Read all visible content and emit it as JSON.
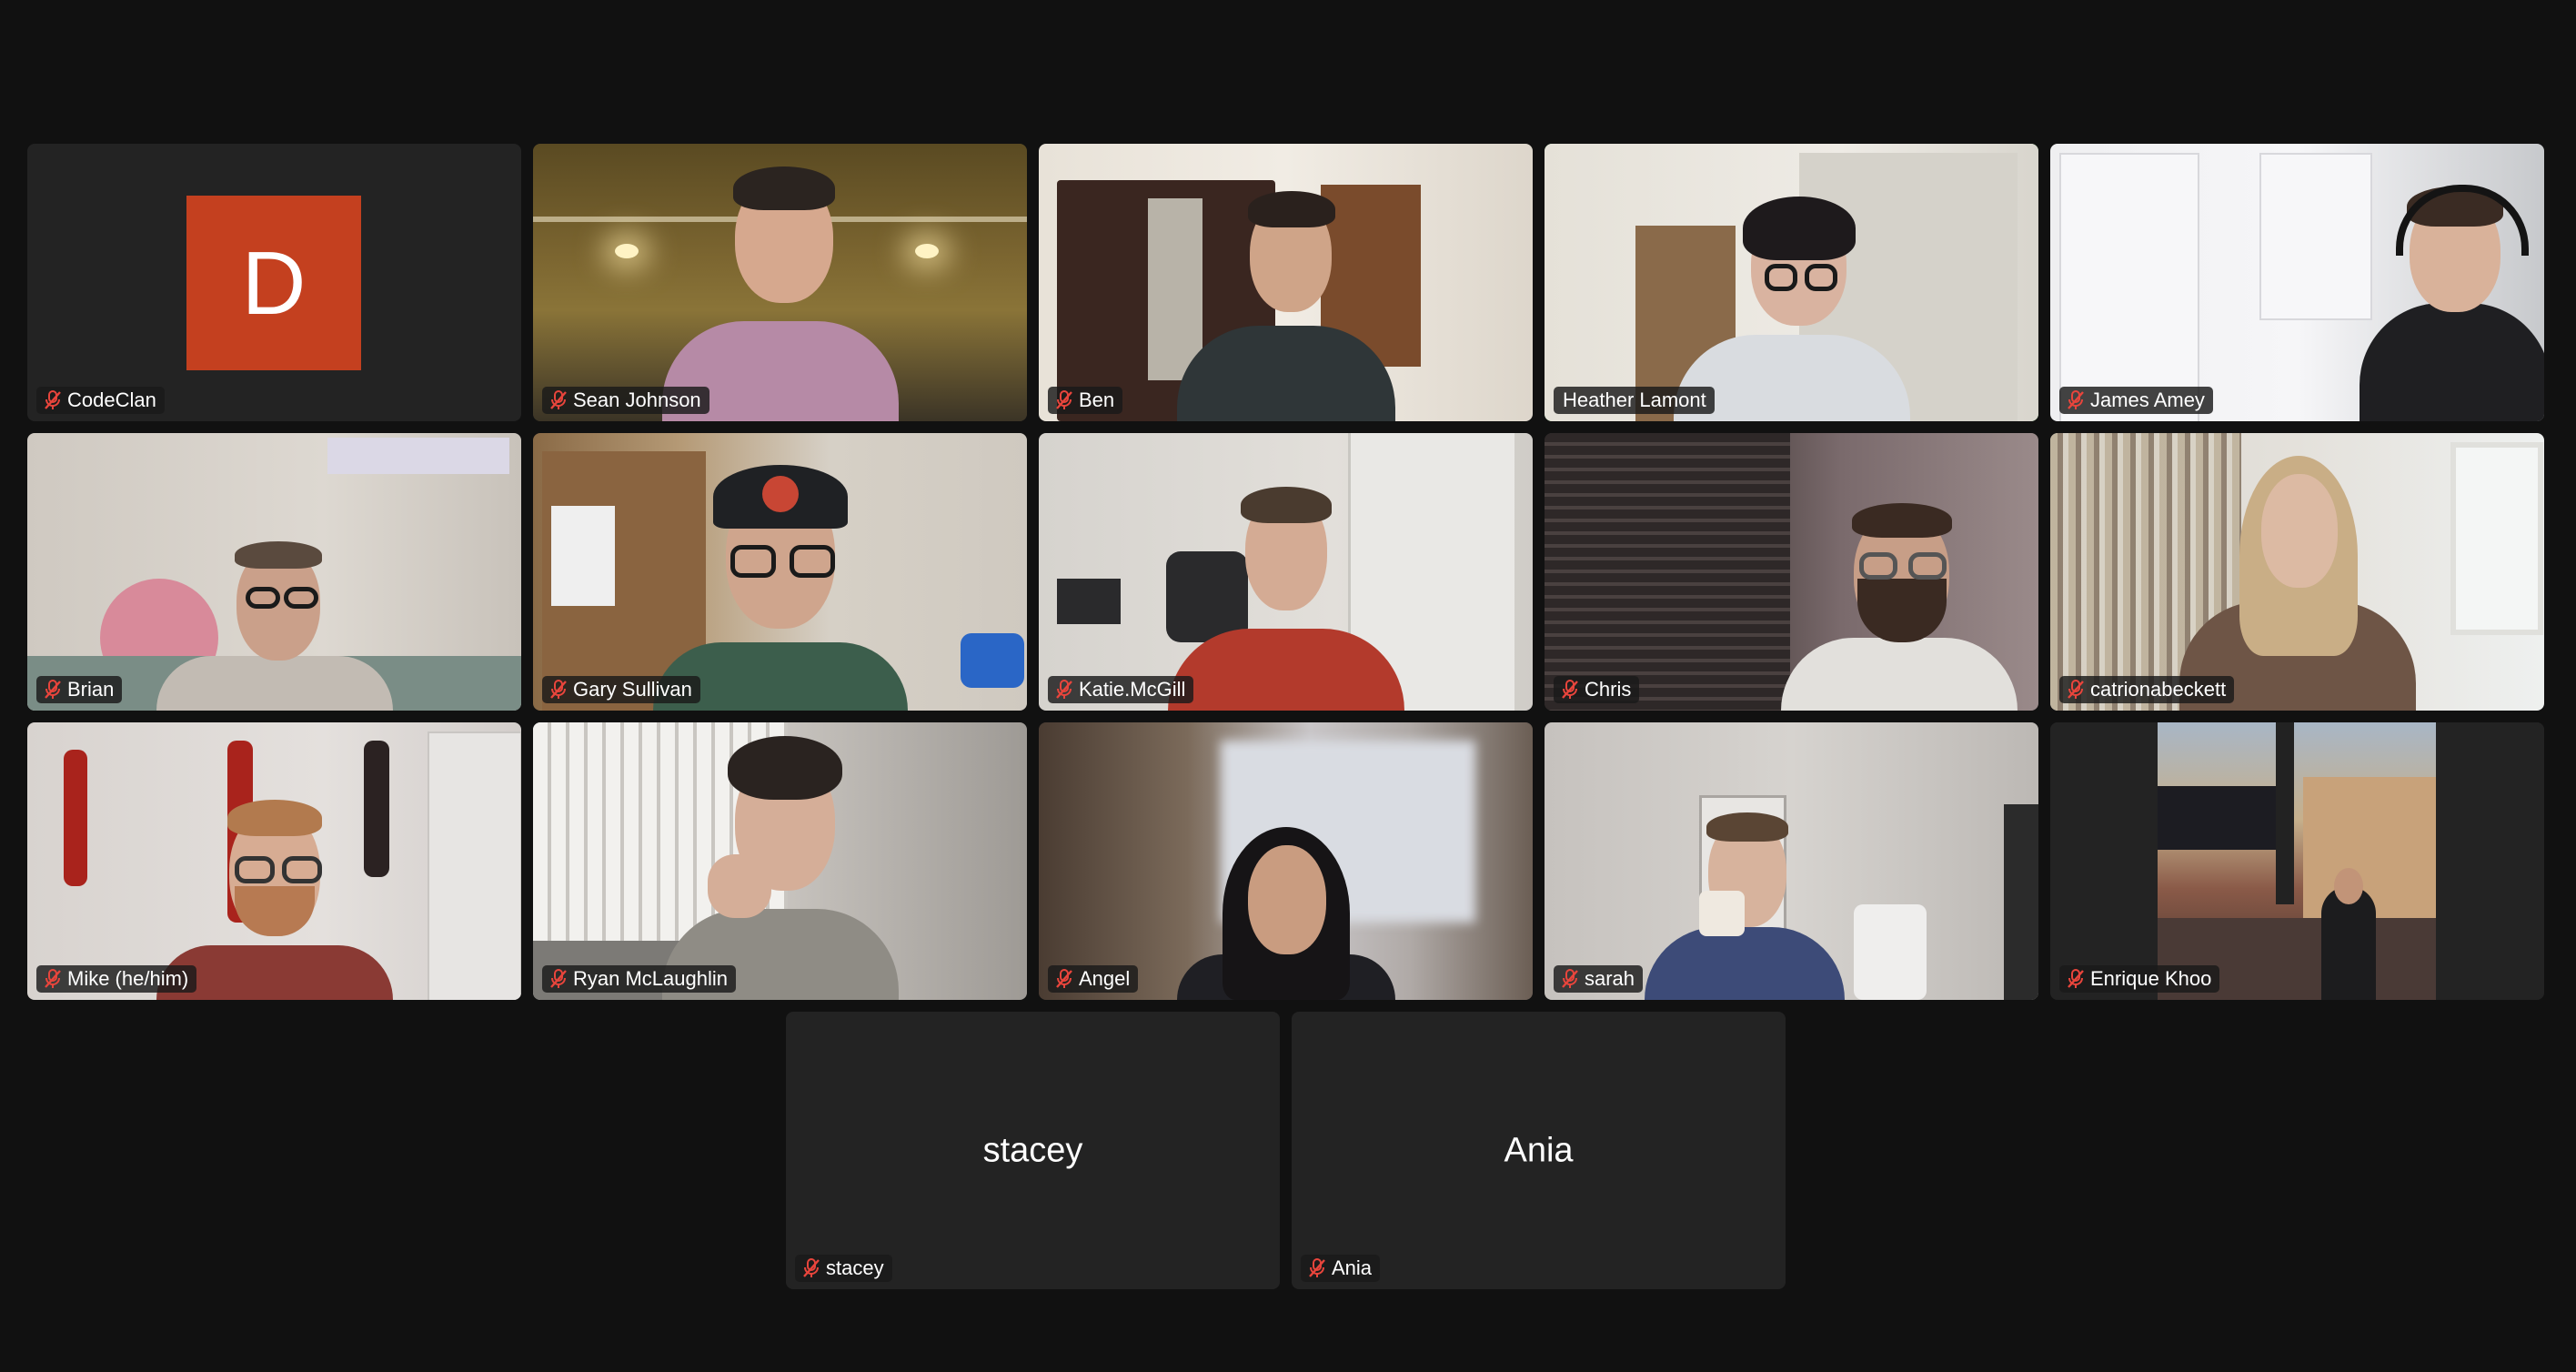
{
  "participants": [
    {
      "name": "CodeClan",
      "muted": true,
      "avatar_letter": "D",
      "avatar_color": "#c4401f"
    },
    {
      "name": "Sean Johnson",
      "muted": true
    },
    {
      "name": "Ben",
      "muted": true
    },
    {
      "name": "Heather Lamont",
      "muted": false,
      "active_speaker": true
    },
    {
      "name": "James Amey",
      "muted": true
    },
    {
      "name": "Brian",
      "muted": true
    },
    {
      "name": "Gary Sullivan",
      "muted": true
    },
    {
      "name": "Katie.McGill",
      "muted": true
    },
    {
      "name": "Chris",
      "muted": true
    },
    {
      "name": "catrionabeckett",
      "muted": true
    },
    {
      "name": "Mike (he/him)",
      "muted": true
    },
    {
      "name": "Ryan McLaughlin",
      "muted": true
    },
    {
      "name": "Angel",
      "muted": true
    },
    {
      "name": "sarah",
      "muted": true
    },
    {
      "name": "Enrique Khoo",
      "muted": true
    },
    {
      "name": "stacey",
      "muted": true,
      "video_off": true,
      "center_label": "stacey"
    },
    {
      "name": "Ania",
      "muted": true,
      "video_off": true,
      "center_label": "Ania"
    }
  ],
  "icons": {
    "mute": "microphone-muted-icon"
  },
  "colors": {
    "background": "#111111",
    "tile": "#232323",
    "active_border": "#5fd16b",
    "mute_icon": "#e8453c"
  }
}
